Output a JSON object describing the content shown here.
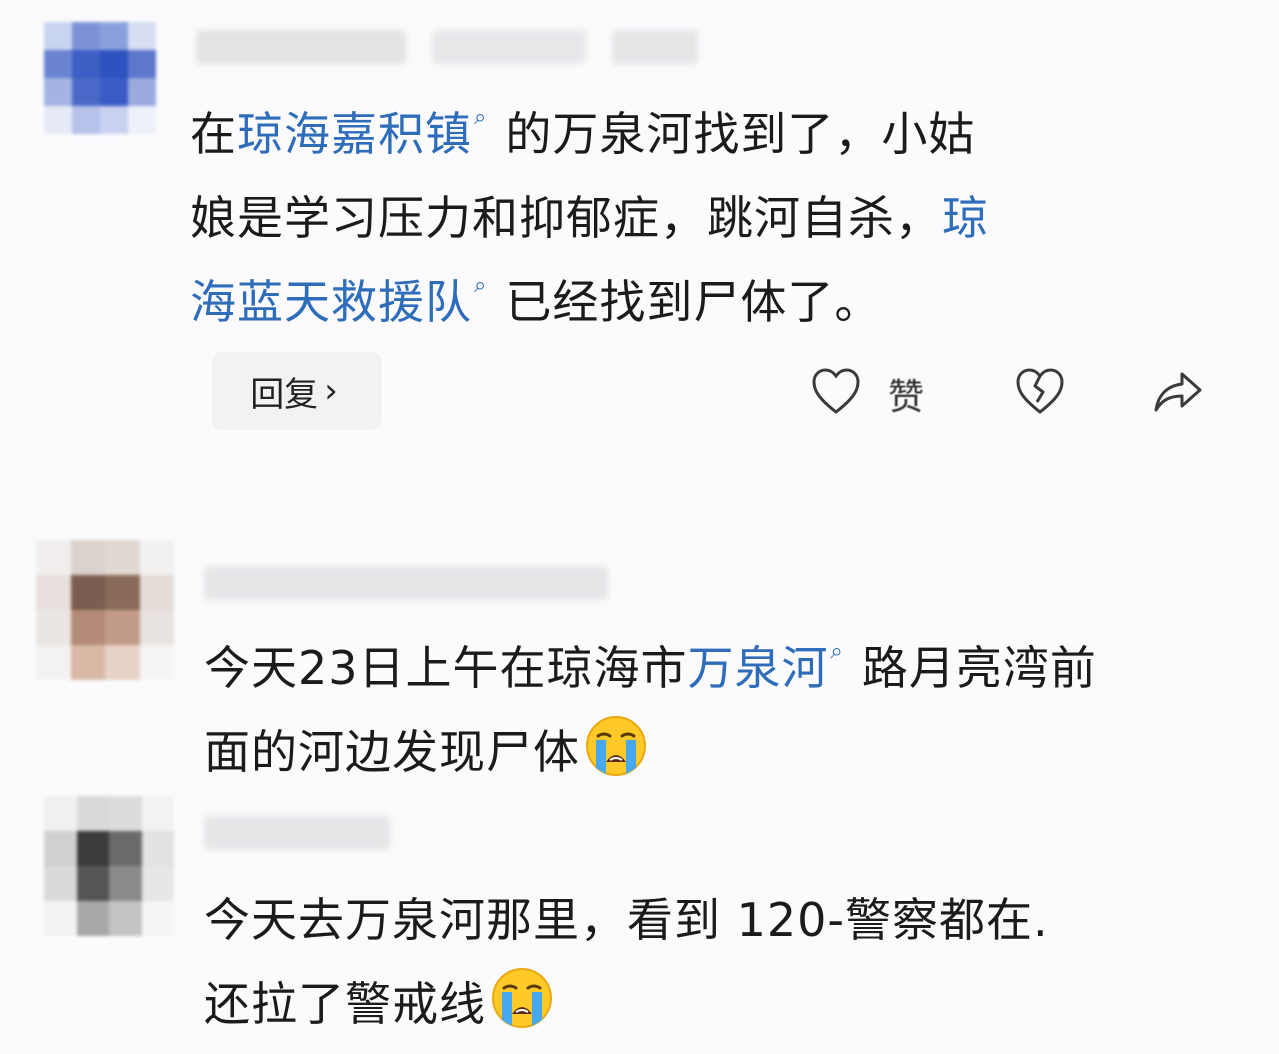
{
  "comments": [
    {
      "segments": [
        {
          "text": "在",
          "link": false
        },
        {
          "text": "琼海嘉积镇",
          "link": true
        },
        {
          "text": "的万泉河找到了，小姑",
          "link": false
        }
      ],
      "line2": [
        {
          "text": "娘是学习压力和抑郁症，跳河自杀，",
          "link": false
        },
        {
          "text": "琼",
          "link": true
        }
      ],
      "line3": [
        {
          "text": "海蓝天救援队",
          "link": true
        },
        {
          "text": "已经找到尸体了。",
          "link": false
        }
      ],
      "actions": {
        "reply_label": "回复",
        "reply_arrow": "›",
        "like_label": "赞",
        "icons": [
          "heart-icon",
          "broken-heart-icon",
          "share-icon"
        ]
      }
    },
    {
      "line1": [
        {
          "text": "今天23日上午在琼海市",
          "link": false
        },
        {
          "text": "万泉河",
          "link": true
        },
        {
          "text": "路月亮湾前",
          "link": false
        }
      ],
      "line2": [
        {
          "text": "面的河边发现尸体",
          "link": false
        }
      ],
      "emoji": "loudly-crying-face"
    },
    {
      "line1": [
        {
          "text": "今天去万泉河那里，看到 120-警察都在.",
          "link": false
        }
      ],
      "line2": [
        {
          "text": "还拉了警戒线",
          "link": false
        }
      ],
      "emoji": "loudly-crying-face"
    }
  ],
  "topic_icon": "search-icon",
  "colors": {
    "link": "#2f6dba",
    "text": "#1b1b1b",
    "background": "#fbfbfd",
    "reply_bg": "#f2f2f4"
  }
}
